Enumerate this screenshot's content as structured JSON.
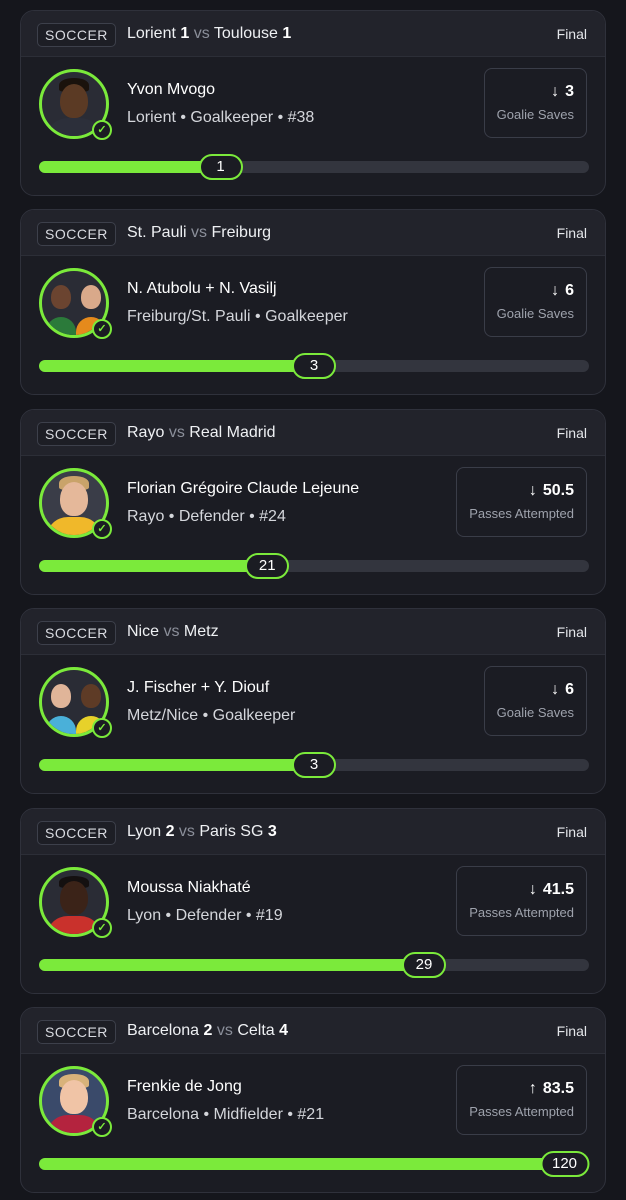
{
  "colors": {
    "accent": "#7bea3b",
    "background": "#15161c",
    "card": "#1b1c23"
  },
  "cards": [
    {
      "sport": "SOCCER",
      "teams": [
        {
          "name": "Lorient",
          "score": "1"
        },
        {
          "name": "Toulouse",
          "score": "1"
        }
      ],
      "vs": "vs",
      "status": "Final",
      "player_name": "Yvon Mvogo",
      "player_meta": "Lorient • Goalkeeper • #38",
      "stat_direction_icon": "arrow-down-icon",
      "stat_arrow": "↓",
      "stat_line": "3",
      "stat_label": "Goalie Saves",
      "progress_value": "1",
      "progress_fraction": 0.33,
      "verified_icon": "check-circle-icon"
    },
    {
      "sport": "SOCCER",
      "teams": [
        {
          "name": "St. Pauli",
          "score": ""
        },
        {
          "name": "Freiburg",
          "score": ""
        }
      ],
      "vs": "vs",
      "status": "Final",
      "player_name": "N. Atubolu + N. Vasilj",
      "player_meta": "Freiburg/St. Pauli • Goalkeeper",
      "stat_direction_icon": "arrow-down-icon",
      "stat_arrow": "↓",
      "stat_line": "6",
      "stat_label": "Goalie Saves",
      "progress_value": "3",
      "progress_fraction": 0.5,
      "verified_icon": "check-circle-icon"
    },
    {
      "sport": "SOCCER",
      "teams": [
        {
          "name": "Rayo",
          "score": ""
        },
        {
          "name": "Real Madrid",
          "score": ""
        }
      ],
      "vs": "vs",
      "status": "Final",
      "player_name": "Florian Grégoire Claude Lejeune",
      "player_meta": "Rayo • Defender • #24",
      "stat_direction_icon": "arrow-down-icon",
      "stat_arrow": "↓",
      "stat_line": "50.5",
      "stat_label": "Passes Attempted",
      "progress_value": "21",
      "progress_fraction": 0.415,
      "verified_icon": "check-circle-icon"
    },
    {
      "sport": "SOCCER",
      "teams": [
        {
          "name": "Nice",
          "score": ""
        },
        {
          "name": "Metz",
          "score": ""
        }
      ],
      "vs": "vs",
      "status": "Final",
      "player_name": "J. Fischer + Y. Diouf",
      "player_meta": "Metz/Nice • Goalkeeper",
      "stat_direction_icon": "arrow-down-icon",
      "stat_arrow": "↓",
      "stat_line": "6",
      "stat_label": "Goalie Saves",
      "progress_value": "3",
      "progress_fraction": 0.5,
      "verified_icon": "check-circle-icon"
    },
    {
      "sport": "SOCCER",
      "teams": [
        {
          "name": "Lyon",
          "score": "2"
        },
        {
          "name": "Paris SG",
          "score": "3"
        }
      ],
      "vs": "vs",
      "status": "Final",
      "player_name": "Moussa Niakhaté",
      "player_meta": "Lyon • Defender • #19",
      "stat_direction_icon": "arrow-down-icon",
      "stat_arrow": "↓",
      "stat_line": "41.5",
      "stat_label": "Passes Attempted",
      "progress_value": "29",
      "progress_fraction": 0.7,
      "verified_icon": "check-circle-icon"
    },
    {
      "sport": "SOCCER",
      "teams": [
        {
          "name": "Barcelona",
          "score": "2"
        },
        {
          "name": "Celta",
          "score": "4"
        }
      ],
      "vs": "vs",
      "status": "Final",
      "player_name": "Frenkie de Jong",
      "player_meta": "Barcelona • Midfielder • #21",
      "stat_direction_icon": "arrow-up-icon",
      "stat_arrow": "↑",
      "stat_line": "83.5",
      "stat_label": "Passes Attempted",
      "progress_value": "120",
      "progress_fraction": 1.0,
      "verified_icon": "check-circle-icon"
    }
  ]
}
